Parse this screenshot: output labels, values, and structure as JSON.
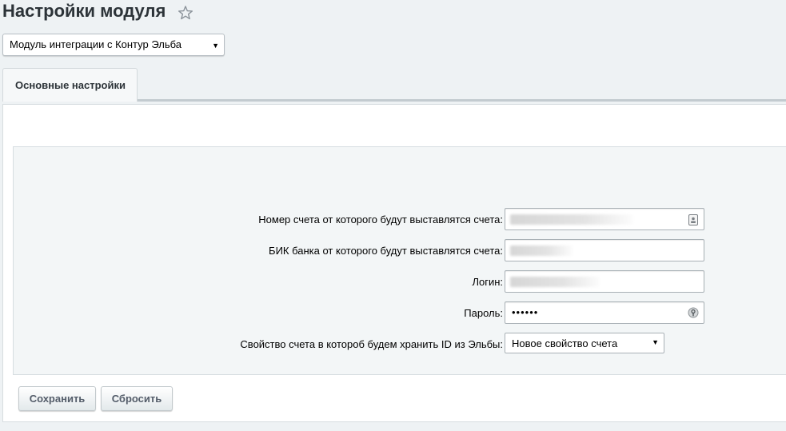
{
  "page": {
    "title": "Настройки модуля",
    "favorite_icon": "star-icon"
  },
  "module_select": {
    "selected": "Модуль интеграции с Контур Эльба",
    "arrow_icon": "dropdown-triangle-icon"
  },
  "tabs": [
    {
      "label": "Основные настройки",
      "active": true
    }
  ],
  "form": {
    "account_number": {
      "label": "Номер счета от которого будут выставлятся счета:",
      "icon": "contact-card-icon"
    },
    "bank_bik": {
      "label": "БИК банка от которого будут выставлятся счета:"
    },
    "login": {
      "label": "Логин:"
    },
    "password": {
      "label": "Пароль:",
      "value": "••••••",
      "icon": "key-icon"
    },
    "id_property": {
      "label": "Свойство счета в котороб будем хранить ID из Эльбы:",
      "selected": "Новое свойство счета"
    }
  },
  "buttons": {
    "save": "Сохранить",
    "reset": "Сбросить"
  },
  "colors": {
    "background": "#eef2f4",
    "title": "#2c3338",
    "button_text": "#535c69"
  }
}
